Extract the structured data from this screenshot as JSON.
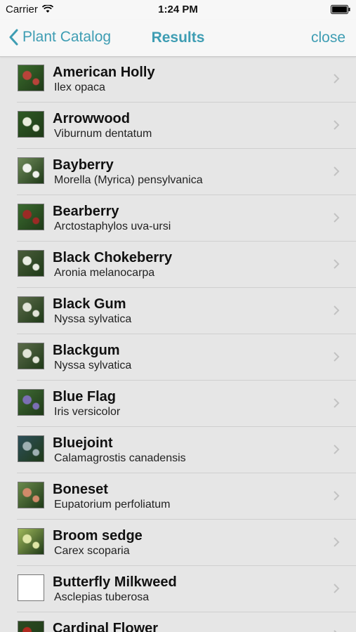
{
  "status": {
    "carrier": "Carrier",
    "time": "1:24 PM"
  },
  "nav": {
    "back_label": "Plant Catalog",
    "title": "Results",
    "close_label": "close"
  },
  "colors": {
    "accent": "#3e9db3",
    "background": "#e6e6e6",
    "bar": "#f7f7f7"
  },
  "plants": [
    {
      "name": "American Holly",
      "scientific": "Ilex opaca",
      "thumb": [
        "#3a6b2c",
        "#b8433a"
      ]
    },
    {
      "name": "Arrowwood",
      "scientific": "Viburnum dentatum",
      "thumb": [
        "#2f5a24",
        "#e8ecdc"
      ]
    },
    {
      "name": "Bayberry",
      "scientific": "Morella (Myrica) pensylvanica",
      "thumb": [
        "#6f8a5a",
        "#f1f3ee"
      ]
    },
    {
      "name": "Bearberry",
      "scientific": "Arctostaphylos uva-ursi",
      "thumb": [
        "#3b6a30",
        "#9b2a25"
      ]
    },
    {
      "name": "Black Chokeberry",
      "scientific": "Aronia melanocarpa",
      "thumb": [
        "#4a5d3a",
        "#e9ece2"
      ]
    },
    {
      "name": "Black Gum",
      "scientific": "Nyssa sylvatica",
      "thumb": [
        "#5b6b4a",
        "#e1e4d8"
      ]
    },
    {
      "name": "Blackgum",
      "scientific": "Nyssa sylvatica",
      "thumb": [
        "#5b6b4a",
        "#e1e4d8"
      ]
    },
    {
      "name": "Blue Flag",
      "scientific": "Iris versicolor",
      "thumb": [
        "#3f6a34",
        "#7b6fb4"
      ]
    },
    {
      "name": "Bluejoint",
      "scientific": "Calamagrostis canadensis",
      "thumb": [
        "#2d4f5a",
        "#9fb0b3"
      ]
    },
    {
      "name": "Boneset",
      "scientific": "Eupatorium perfoliatum",
      "thumb": [
        "#6a8a4c",
        "#d08a6a"
      ]
    },
    {
      "name": "Broom sedge",
      "scientific": "Carex scoparia",
      "thumb": [
        "#9fb85a",
        "#dfe6a6"
      ]
    },
    {
      "name": "Butterfly Milkweed",
      "scientific": "Asclepias tuberosa",
      "thumb": [
        "#ffffff",
        "#ffffff"
      ]
    },
    {
      "name": "Cardinal Flower",
      "scientific": "",
      "thumb": [
        "#2c4a22",
        "#b02a20"
      ]
    }
  ]
}
